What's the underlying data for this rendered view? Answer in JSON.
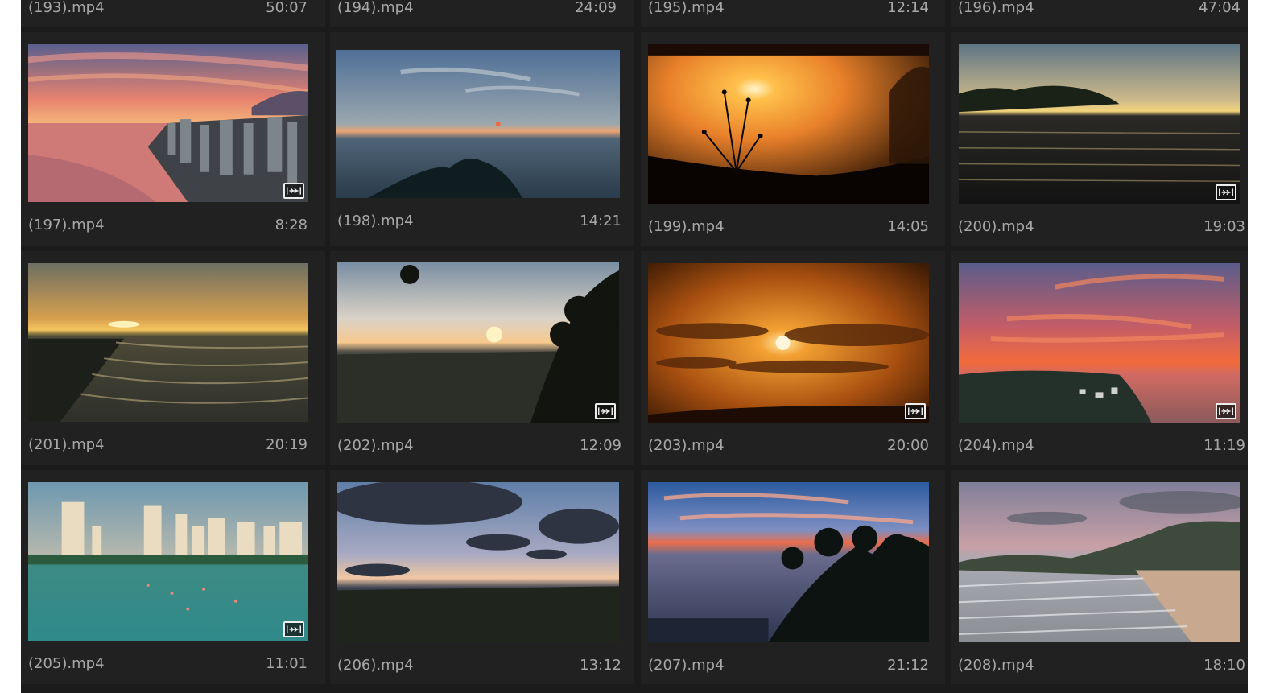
{
  "top_row": [
    {
      "name": "(193).mp4",
      "duration": "50:07"
    },
    {
      "name": "(194).mp4",
      "duration": "24:09"
    },
    {
      "name": "(195).mp4",
      "duration": "12:14"
    },
    {
      "name": "(196).mp4",
      "duration": "47:04"
    }
  ],
  "clips": [
    {
      "name": "(197).mp4",
      "duration": "8:28",
      "scene": "sunset-city-coast",
      "linked_audio": true
    },
    {
      "name": "(198).mp4",
      "duration": "14:21",
      "scene": "hazy-blue-sunset-hill",
      "linked_audio": false
    },
    {
      "name": "(199).mp4",
      "duration": "14:05",
      "scene": "orange-sun-plant-silhouette",
      "linked_audio": false
    },
    {
      "name": "(200).mp4",
      "duration": "19:03",
      "scene": "lake-sunset-tree-line",
      "linked_audio": true
    },
    {
      "name": "(201).mp4",
      "duration": "20:19",
      "scene": "beach-waves-sunset",
      "linked_audio": false
    },
    {
      "name": "(202).mp4",
      "duration": "12:09",
      "scene": "valley-sunset-tree",
      "linked_audio": true
    },
    {
      "name": "(203).mp4",
      "duration": "20:00",
      "scene": "orange-cloud-sunset",
      "linked_audio": true
    },
    {
      "name": "(204).mp4",
      "duration": "11:19",
      "scene": "red-sky-coast-town",
      "linked_audio": true
    },
    {
      "name": "(205).mp4",
      "duration": "11:01",
      "scene": "turquoise-bay-skyline",
      "linked_audio": true
    },
    {
      "name": "(206).mp4",
      "duration": "13:12",
      "scene": "dark-clouds-dusk",
      "linked_audio": false
    },
    {
      "name": "(207).mp4",
      "duration": "21:12",
      "scene": "tropical-palm-sunset",
      "linked_audio": false
    },
    {
      "name": "(208).mp4",
      "duration": "18:10",
      "scene": "pink-beach-mountain",
      "linked_audio": false
    }
  ],
  "icons": {
    "linked_audio": "linked-av-icon"
  },
  "colors": {
    "panel": "#1b1b1b",
    "cell": "#212121",
    "text": "#a8a8a8"
  }
}
